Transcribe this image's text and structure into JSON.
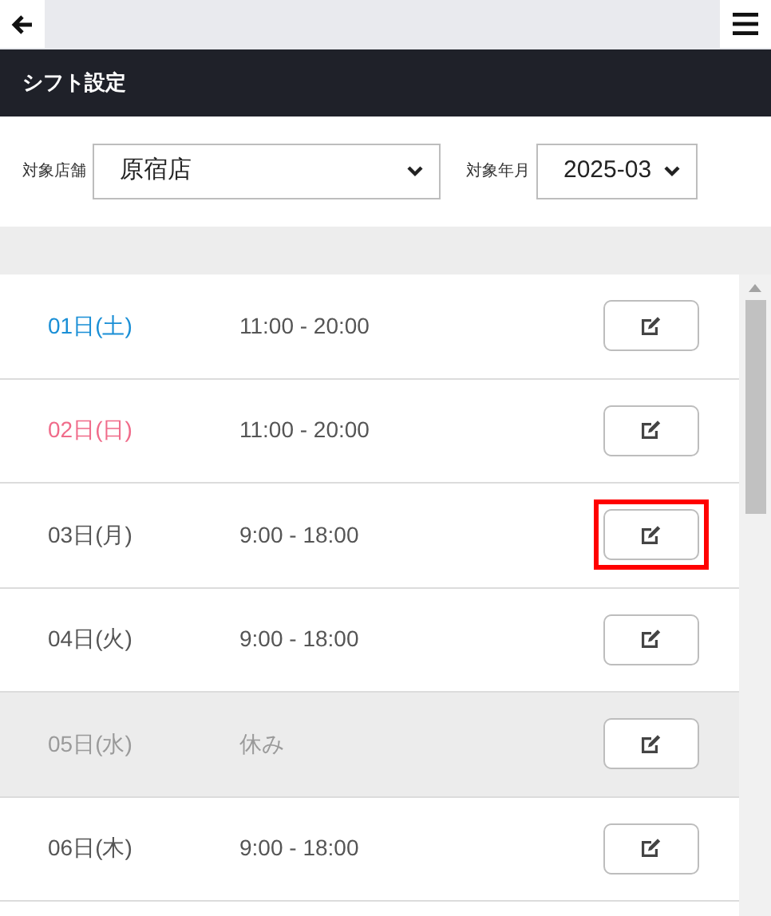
{
  "header": {
    "title": "シフト設定"
  },
  "filters": [
    {
      "label": "対象店舗",
      "value": "原宿店"
    },
    {
      "label": "対象年月",
      "value": "2025-03"
    }
  ],
  "shifts": [
    {
      "date": "01日(土)",
      "time": "11:00 - 20:00",
      "kind": "saturday",
      "highlighted": false
    },
    {
      "date": "02日(日)",
      "time": "11:00 - 20:00",
      "kind": "sunday",
      "highlighted": false
    },
    {
      "date": "03日(月)",
      "time": "9:00 - 18:00",
      "kind": "weekday",
      "highlighted": true
    },
    {
      "date": "04日(火)",
      "time": "9:00 - 18:00",
      "kind": "weekday",
      "highlighted": false
    },
    {
      "date": "05日(水)",
      "time": "休み",
      "kind": "off",
      "highlighted": false
    },
    {
      "date": "06日(木)",
      "time": "9:00 - 18:00",
      "kind": "weekday",
      "highlighted": false
    }
  ]
}
